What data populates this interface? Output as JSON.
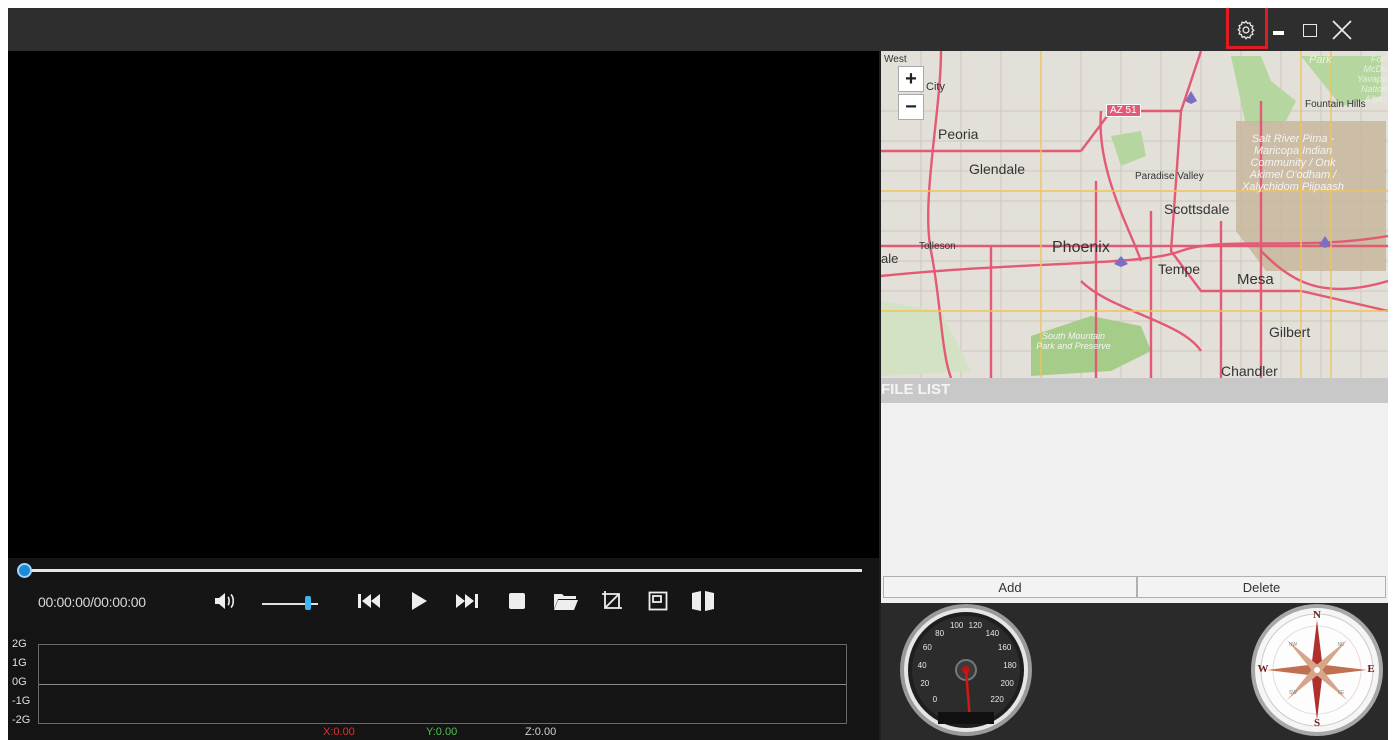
{
  "window": {
    "controls": [
      "settings-icon",
      "minimize-icon",
      "maximize-icon",
      "close-icon"
    ],
    "highlight_color": "#e21b23"
  },
  "player": {
    "time": "00:00:00/00:00:00",
    "progress": 0.0,
    "volume": 0.75,
    "accent_color": "#1e88d8",
    "buttons": [
      "volume-icon",
      "previous-icon",
      "play-icon",
      "next-icon",
      "stop-icon",
      "open-folder-icon",
      "crop-icon",
      "window-icon",
      "split-view-icon"
    ]
  },
  "graph": {
    "ylabels": [
      "2G",
      "1G",
      "0G",
      "-1G",
      "-2G"
    ],
    "x_label": "X:0.00",
    "y_label": "Y:0.00",
    "z_label": "Z:0.00",
    "x_color": "#e03030",
    "y_color": "#50c050",
    "z_color": "#d0d0d0"
  },
  "map": {
    "zoom_in": "+",
    "zoom_out": "−",
    "labels": {
      "west": "West",
      "city": "City",
      "az51": "AZ 51",
      "peoria": "Peoria",
      "glendale": "Glendale",
      "paradise_valley": "Paradise Valley",
      "scottsdale": "Scottsdale",
      "tolleson": "Tolleson",
      "ale": "ale",
      "phoenix": "Phoenix",
      "tempe": "Tempe",
      "mesa": "Mesa",
      "gilbert": "Gilbert",
      "chandler": "Chandler",
      "fountain_hills": "Fountain Hills",
      "park": "Park",
      "fort_mcdowell": "Fort McDo Yavapa Nation A'ba:j",
      "salt_river": "Salt River Pima - Maricopa Indian Community / Onk Akimel O'odham / Xalychidom Piipaash",
      "south_mountain": "South Mountain Park and Preserve"
    }
  },
  "file_list": {
    "header": "FILE LIST",
    "add_label": "Add",
    "delete_label": "Delete",
    "items": []
  },
  "gauges": {
    "speed_ticks": [
      "0",
      "20",
      "40",
      "60",
      "80",
      "100",
      "120",
      "140",
      "160",
      "180",
      "200",
      "220"
    ],
    "speed": 0,
    "compass_letters": [
      "N",
      "E",
      "S",
      "W"
    ],
    "compass_minor": [
      "NW",
      "NE",
      "SE",
      "SW"
    ]
  }
}
